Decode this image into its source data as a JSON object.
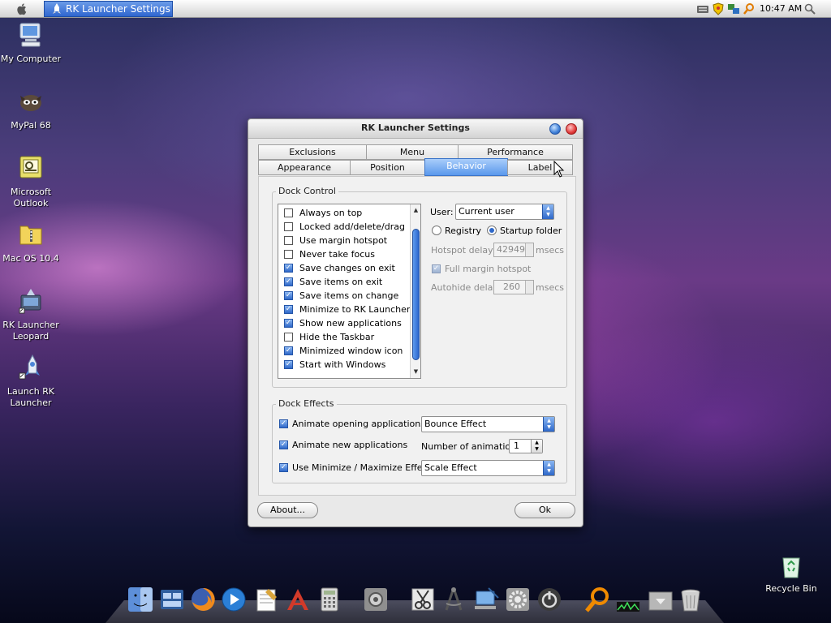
{
  "menubar": {
    "task_title": "RK Launcher Settings",
    "clock": "10:47 AM"
  },
  "desktop": {
    "icons": [
      {
        "label": "My Computer",
        "icon": "my-computer-icon"
      },
      {
        "label": "MyPal 68",
        "icon": "mypal-icon"
      },
      {
        "label": "Microsoft Outlook",
        "icon": "outlook-icon"
      },
      {
        "label": "Mac OS 10.4",
        "icon": "zip-folder-icon"
      },
      {
        "label": "RK Launcher Leopard",
        "icon": "rk-launcher-icon"
      },
      {
        "label": "Launch RK Launcher",
        "icon": "rocket-icon"
      }
    ],
    "recycle_bin": "Recycle Bin"
  },
  "dialog": {
    "title": "RK Launcher Settings",
    "tabs_back": [
      "Exclusions",
      "Menu",
      "Performance"
    ],
    "tabs_front": [
      "Appearance",
      "Position",
      "Behavior",
      "Label"
    ],
    "active_tab": "Behavior",
    "dock_control": {
      "title": "Dock Control",
      "items": [
        {
          "label": "Always on top",
          "checked": false
        },
        {
          "label": "Locked add/delete/drag",
          "checked": false
        },
        {
          "label": "Use margin hotspot",
          "checked": false
        },
        {
          "label": "Never take focus",
          "checked": false
        },
        {
          "label": "Save changes on exit",
          "checked": true
        },
        {
          "label": "Save items on exit",
          "checked": true
        },
        {
          "label": "Save items on change",
          "checked": true
        },
        {
          "label": "Minimize to RK Launcher",
          "checked": true
        },
        {
          "label": "Show new applications",
          "checked": true
        },
        {
          "label": "Hide the Taskbar",
          "checked": false
        },
        {
          "label": "Minimized window icon",
          "checked": true
        },
        {
          "label": "Start with Windows",
          "checked": true
        }
      ],
      "user_label": "User:",
      "user_value": "Current user",
      "radio_registry": "Registry",
      "radio_startup": "Startup folder",
      "hotspot_label": "Hotspot delay:",
      "hotspot_value": "42949",
      "msecs": "msecs",
      "full_margin_label": "Full margin hotspot",
      "autohide_label": "Autohide delay:",
      "autohide_value": "260"
    },
    "dock_effects": {
      "title": "Dock Effects",
      "animate_opening": "Animate opening applications",
      "animate_new": "Animate new applications",
      "use_minimize": "Use Minimize / Maximize Effect",
      "opening_effect": "Bounce Effect",
      "num_label": "Number of animations",
      "num_value": "1",
      "minimize_effect": "Scale Effect"
    },
    "about_button": "About...",
    "ok_button": "Ok"
  }
}
